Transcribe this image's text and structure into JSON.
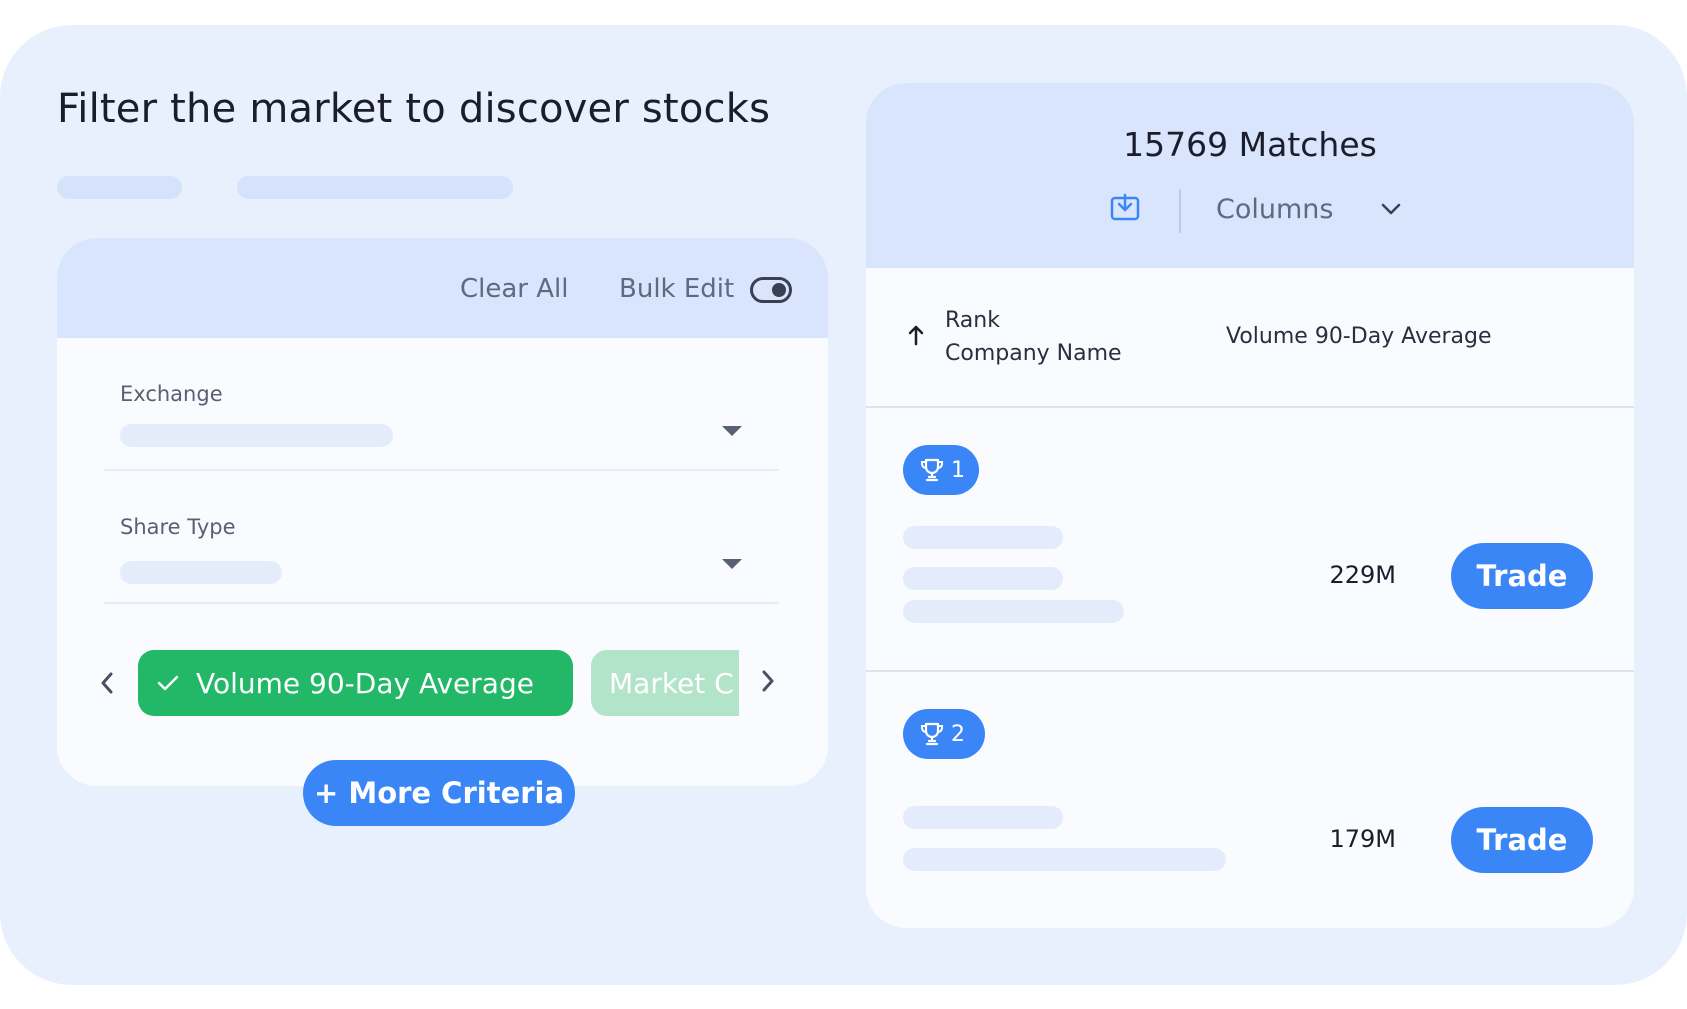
{
  "headline": "Filter the market to discover stocks",
  "filter_panel": {
    "clear_all": "Clear All",
    "bulk_edit": "Bulk Edit",
    "bulk_edit_toggle_on": true,
    "fields": [
      {
        "label": "Exchange"
      },
      {
        "label": "Share Type"
      }
    ],
    "chips": [
      {
        "label": "Volume 90-Day Average",
        "active": true
      },
      {
        "label": "Market C",
        "active": false
      }
    ],
    "more_criteria": "+ More Criteria"
  },
  "results": {
    "matches": "15769 Matches",
    "columns_label": "Columns",
    "columns": {
      "rank": "Rank",
      "company_name": "Company Name",
      "volume": "Volume 90-Day Average"
    },
    "rows": [
      {
        "rank": "1",
        "value": "229M",
        "action": "Trade"
      },
      {
        "rank": "2",
        "value": "179M",
        "action": "Trade"
      }
    ]
  },
  "colors": {
    "accent_blue": "#3b86f7",
    "chip_green": "#22b867",
    "chip_green_faded": "#b2e4c9",
    "panel_header": "#d9e5fc",
    "background": "#e9f0fd"
  }
}
